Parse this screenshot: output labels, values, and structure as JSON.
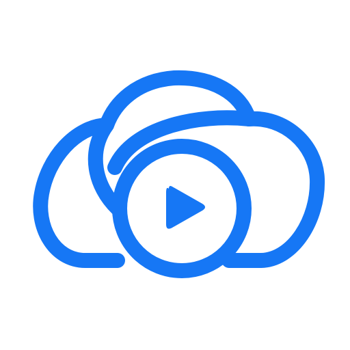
{
  "logo": {
    "name": "cloud-video-play-logo",
    "icon": "cloud-with-play-button-icon",
    "color": "#1677F5",
    "background": "#FFFFFF"
  }
}
